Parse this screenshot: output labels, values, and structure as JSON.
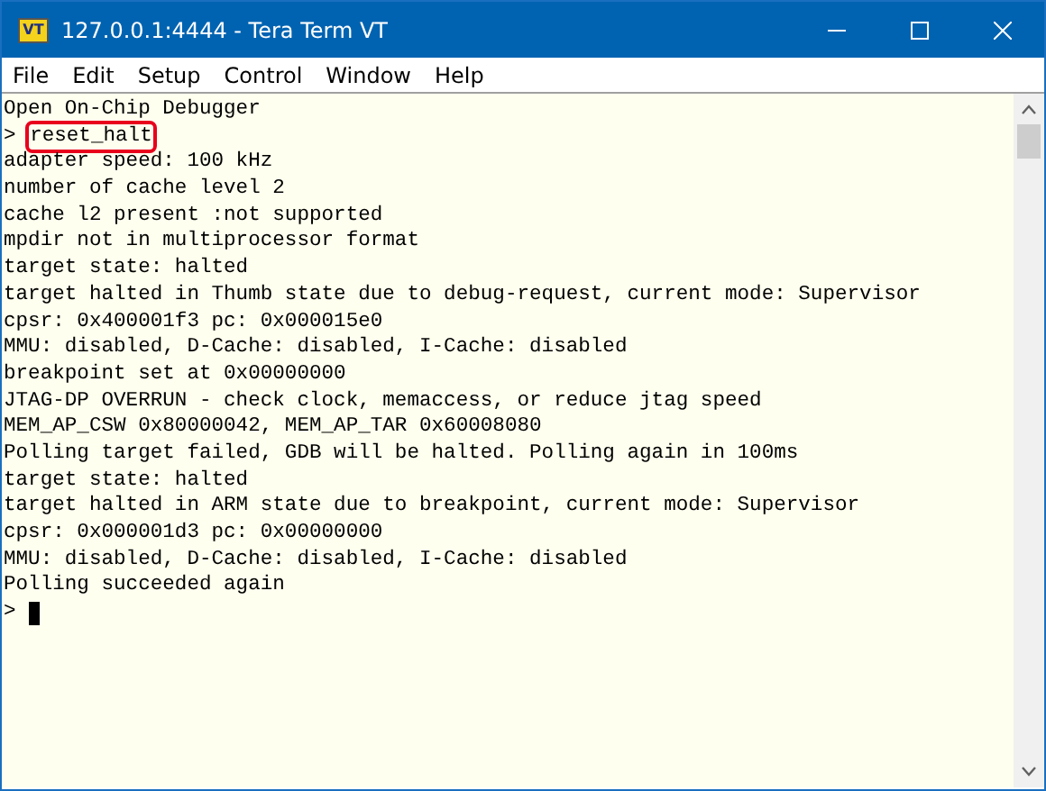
{
  "window": {
    "title": "127.0.0.1:4444 - Tera Term VT",
    "icon_text": "VT"
  },
  "menu": [
    {
      "label": "File"
    },
    {
      "label": "Edit"
    },
    {
      "label": "Setup"
    },
    {
      "label": "Control"
    },
    {
      "label": "Window"
    },
    {
      "label": "Help"
    }
  ],
  "terminal": {
    "lines": [
      {
        "kind": "output",
        "text": "Open On-Chip Debugger"
      },
      {
        "kind": "command",
        "prompt": ">",
        "text": "reset_halt",
        "highlighted": true
      },
      {
        "kind": "output",
        "text": "adapter speed: 100 kHz"
      },
      {
        "kind": "output",
        "text": "number of cache level 2"
      },
      {
        "kind": "output",
        "text": "cache l2 present :not supported"
      },
      {
        "kind": "output",
        "text": "mpdir not in multiprocessor format"
      },
      {
        "kind": "output",
        "text": "target state: halted"
      },
      {
        "kind": "output",
        "text": "target halted in Thumb state due to debug-request, current mode: Supervisor"
      },
      {
        "kind": "output",
        "text": "cpsr: 0x400001f3 pc: 0x000015e0"
      },
      {
        "kind": "output",
        "text": "MMU: disabled, D-Cache: disabled, I-Cache: disabled"
      },
      {
        "kind": "output",
        "text": "breakpoint set at 0x00000000"
      },
      {
        "kind": "output",
        "text": "JTAG-DP OVERRUN - check clock, memaccess, or reduce jtag speed"
      },
      {
        "kind": "output",
        "text": "MEM_AP_CSW 0x80000042, MEM_AP_TAR 0x60008080"
      },
      {
        "kind": "output",
        "text": "Polling target failed, GDB will be halted. Polling again in 100ms"
      },
      {
        "kind": "output",
        "text": "target state: halted"
      },
      {
        "kind": "output",
        "text": "target halted in ARM state due to breakpoint, current mode: Supervisor"
      },
      {
        "kind": "output",
        "text": "cpsr: 0x000001d3 pc: 0x00000000"
      },
      {
        "kind": "output",
        "text": "MMU: disabled, D-Cache: disabled, I-Cache: disabled"
      },
      {
        "kind": "output",
        "text": "Polling succeeded again"
      },
      {
        "kind": "input",
        "prompt": ">",
        "cursor": true
      }
    ]
  }
}
